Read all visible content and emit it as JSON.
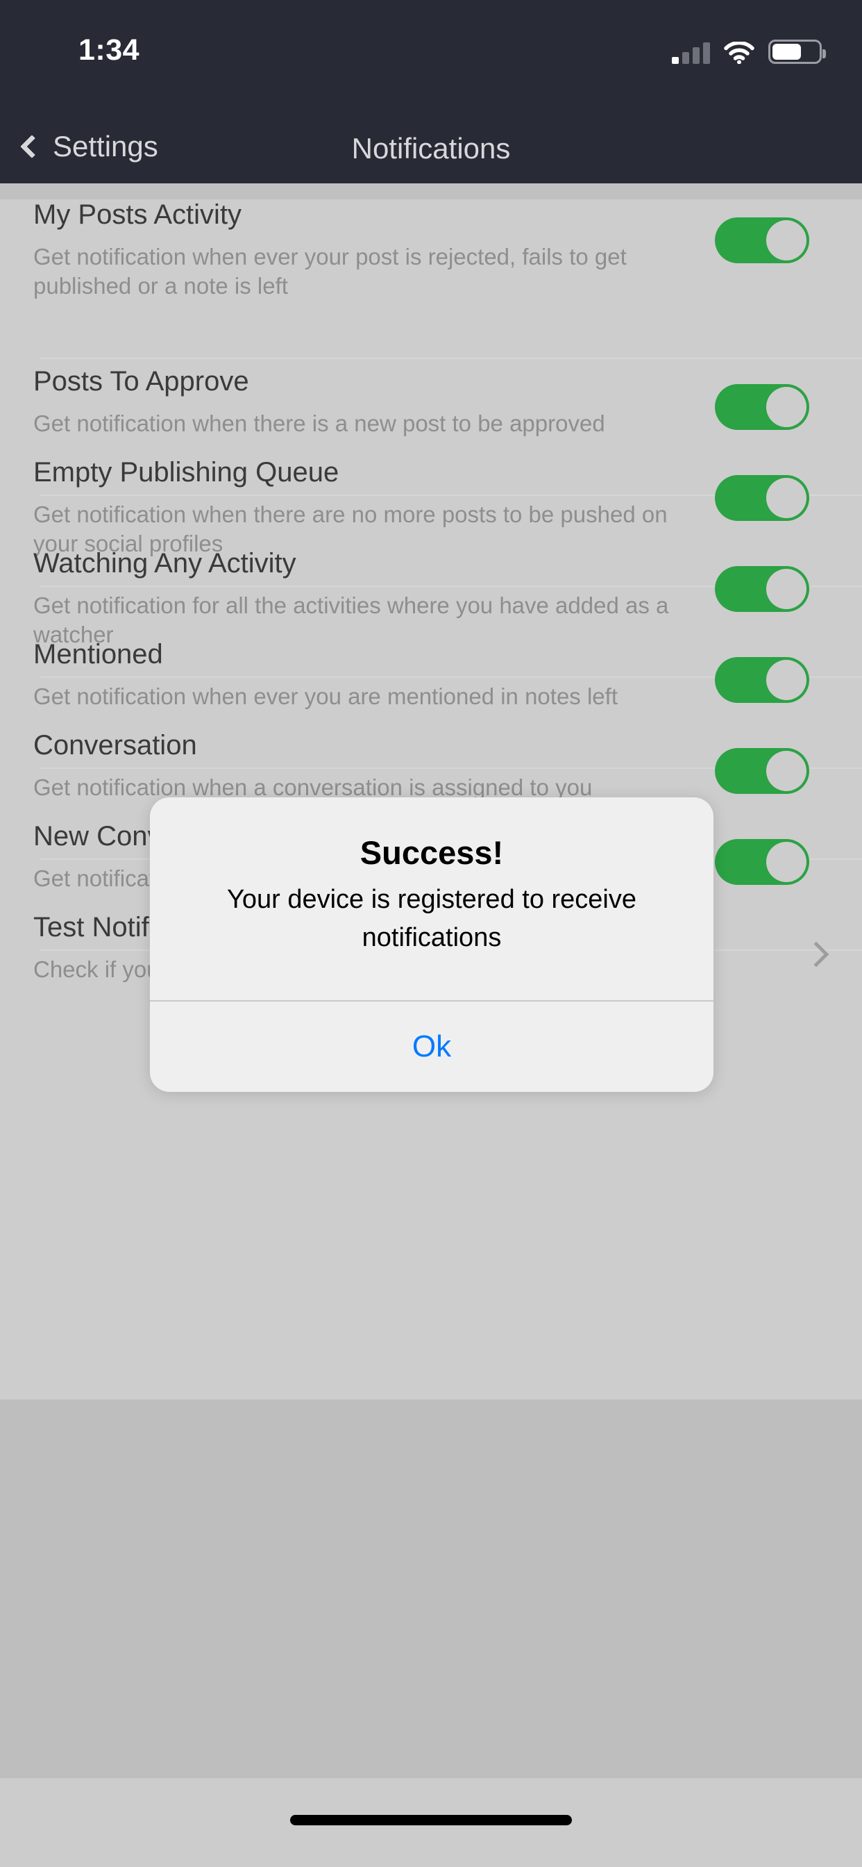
{
  "status_bar": {
    "time": "1:34",
    "signal_icon": "cellular-signal-icon",
    "wifi_icon": "wifi-icon",
    "battery_icon": "battery-icon",
    "battery_level_pct": 58
  },
  "nav_bar": {
    "back_label": "Settings",
    "back_icon": "chevron-left-icon",
    "title": "Notifications"
  },
  "colors": {
    "navbar_bg": "#282b35",
    "content_bg": "#cdcdcd",
    "toggle_on": "#2ba244",
    "accent_blue": "#007aff",
    "title_text": "#3a3a3a",
    "subtitle_text": "#8e8e8e"
  },
  "rows": [
    {
      "title": "My Posts Activity",
      "subtitle": "Get notification when ever your post is rejected, fails to get published or a note is left",
      "control": "toggle",
      "value": "on"
    },
    {
      "title": "Posts To Approve",
      "subtitle": "Get notification when there is a new post to be approved",
      "control": "toggle",
      "value": "on"
    },
    {
      "title": "Empty Publishing Queue",
      "subtitle": "Get notification when there are no more posts to be pushed on your social profiles",
      "control": "toggle",
      "value": "on"
    },
    {
      "title": "Watching Any Activity",
      "subtitle": "Get notification for all the activities where you have added as a watcher",
      "control": "toggle",
      "value": "on"
    },
    {
      "title": "Mentioned",
      "subtitle": "Get notification when ever you are mentioned in notes left",
      "control": "toggle",
      "value": "on"
    },
    {
      "title": "Conversation",
      "subtitle": "Get notification when a conversation is assigned to you",
      "control": "toggle",
      "value": "on"
    },
    {
      "title": "New Conversation",
      "subtitle": "Get notification when ever a new conversation is received",
      "control": "toggle",
      "value": "on"
    },
    {
      "title": "Test Notification",
      "subtitle": "Check if your device is able to receive notifications",
      "control": "chevron",
      "value": ""
    }
  ],
  "alert": {
    "title": "Success!",
    "message": "Your device is registered to receive notifications",
    "ok_label": "Ok"
  }
}
